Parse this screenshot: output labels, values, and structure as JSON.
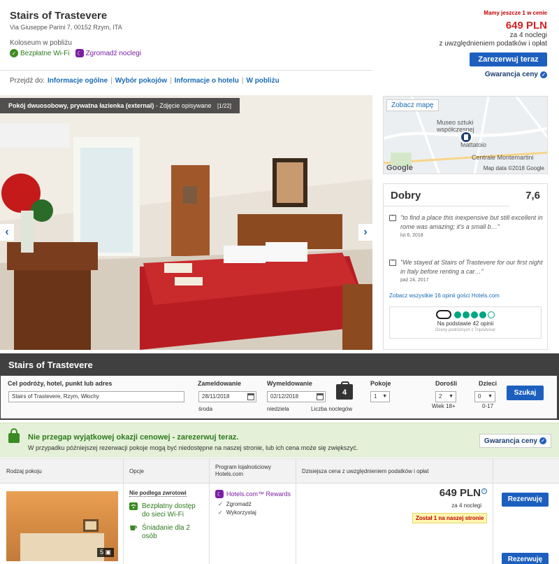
{
  "hotel": {
    "name": "Stairs of Trastevere",
    "address": "Via Giuseppe Parini 7, 00152 Rzym, ITA",
    "landmark": "Koloseum w pobliżu",
    "amenities": [
      "Bezpłatne Wi-Fi",
      "Zgromadź noclegi"
    ]
  },
  "jump_nav": {
    "label": "Przejdź do:",
    "links": [
      "Informacje ogólne",
      "Wybór pokojów",
      "Informacje o hotelu",
      "W pobliżu"
    ]
  },
  "price_box": {
    "scarcity": "Mamy jeszcze 1 w cenie",
    "price": "649 PLN",
    "nights": "za 4 noclegi",
    "taxes": "z uwzględnieniem podatków i opłat",
    "book_button": "Zarezerwuj teraz",
    "guarantee": "Gwarancja ceny"
  },
  "gallery": {
    "caption_title": "Pokój dwuosobowy, prywatna łazienka (external)",
    "caption_sep": "-",
    "caption_desc": "Zdjęcie opisywane",
    "counter": "[1/22]"
  },
  "map": {
    "see_map": "Zobacz mapę",
    "labels": [
      "Museo sztuki współczesnej",
      "Mattatoio",
      "Centrale Montemartini"
    ],
    "credit": "Map data ©2018 Google",
    "logo": "Google"
  },
  "reviews": {
    "rating_word": "Dobry",
    "rating_score": "7,6",
    "items": [
      {
        "text": "\"to find a place this inexpensive but still excellent in rome was amazing; it's a small b…\"",
        "date": "lut 6, 2018"
      },
      {
        "text": "\"We stayed at Stairs of Trastevere for our first night in Italy before renting a car…\"",
        "date": "paź 24, 2017"
      }
    ],
    "all_link": "Zobacz wszystkie 16 opinii gości Hotels.com",
    "tripadvisor": {
      "rating": 4,
      "max": 5,
      "based_on": "Na podstawie 42 opinii",
      "source": "Oceny podróżnych z TripAdvisor"
    }
  },
  "search": {
    "title": "Stairs of Trastevere",
    "destination_label": "Cel podróży, hotel, punkt lub adres",
    "destination_value": "Stairs of Trastevere, Rzym, Włochy",
    "checkin_label": "Zameldowanie",
    "checkin_value": "28/11/2018",
    "checkin_day": "środa",
    "checkout_label": "Wymeldowanie",
    "checkout_value": "02/12/2018",
    "checkout_day": "niedziela",
    "nights_value": "4",
    "nights_label": "Liczba noclegów",
    "rooms_label": "Pokoje",
    "rooms_value": "1",
    "adults_label": "Dorośli",
    "adults_value": "2",
    "adults_sub": "Wiek 18+",
    "children_label": "Dzieci",
    "children_value": "0",
    "children_sub": "0-17",
    "search_button": "Szukaj"
  },
  "deal": {
    "title": "Nie przegap wyjątkowej okazji cenowej - zarezerwuj teraz.",
    "subtitle": "W przypadku późniejszej rezerwacji pokoje mogą być niedostępne na naszej stronie, lub ich cena może się zwiększyć.",
    "guarantee_button": "Gwarancja ceny"
  },
  "rooms_table": {
    "headers": {
      "room_type": "Rodzaj pokoju",
      "options": "Opcje",
      "loyalty_line1": "Program lojalnościowy",
      "loyalty_line2": "Hotels.com",
      "price": "Dzisiejsza cena z uwzględnieniem podatków i opłat"
    },
    "row": {
      "photo_count": "5",
      "refund": "Nie podlega zwrotowi",
      "options": [
        "Bezpłatny dostęp do sieci Wi-Fi",
        "Śniadanie dla 2 osób"
      ],
      "loyalty_title": "Hotels.com™ Rewards",
      "loyalty_items": [
        "Zgromadź",
        "Wykorzystaj"
      ],
      "price": "649 PLN",
      "nights": "za 4 noclegi",
      "left": "Został 1 na naszej stronie",
      "reserve_button": "Rezerwuję",
      "reserve_button_2": "Rezerwuję"
    }
  },
  "colors": {
    "accent": "#1d5fbf",
    "price_red": "#d32323",
    "green": "#2f7a1e",
    "rewards_purple": "#7a1fa2",
    "dark_bar": "#404040"
  }
}
